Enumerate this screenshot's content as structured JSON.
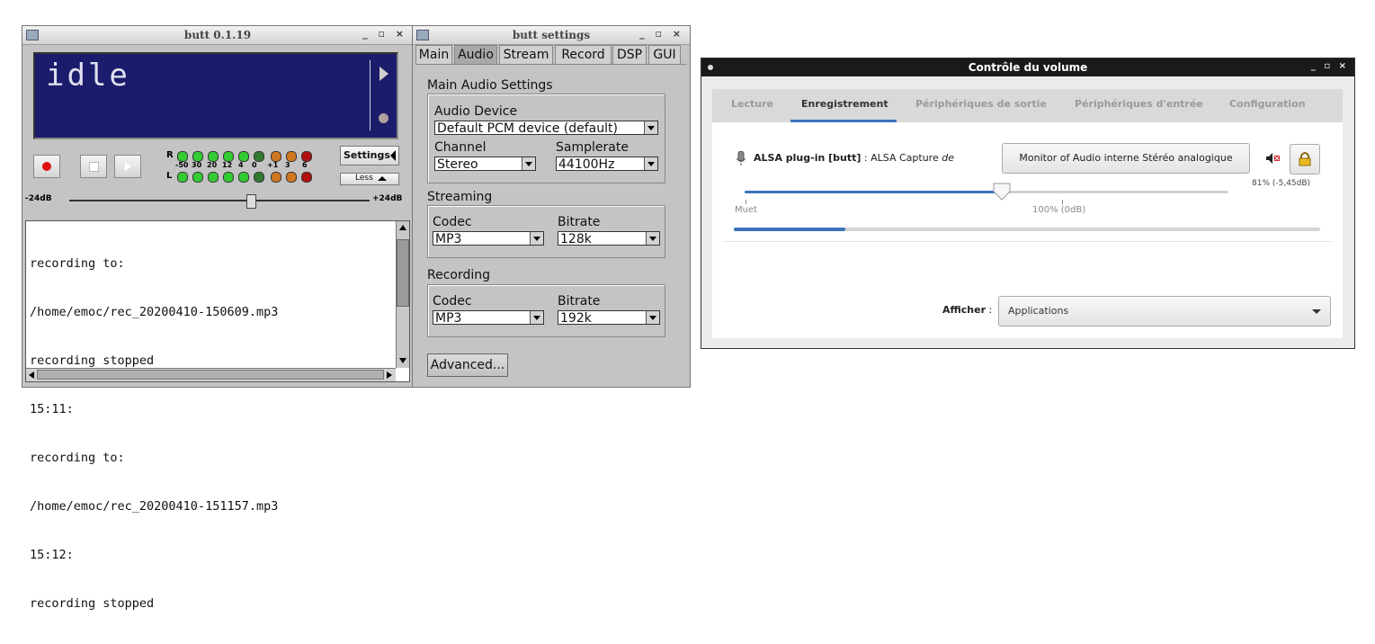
{
  "butt": {
    "title": "butt 0.1.19",
    "window_controls": "_ ▫ ×",
    "display_text": "idle",
    "vu": {
      "r_label": "R",
      "l_label": "L",
      "scale": [
        "-50",
        "30",
        "20",
        "12",
        "4",
        "0",
        "+1",
        "3",
        "6"
      ]
    },
    "settings_button": "Settings",
    "less_button": "Less",
    "gain_min": "-24dB",
    "gain_max": "+24dB",
    "log_lines": [
      "recording to:",
      "/home/emoc/rec_20200410-150609.mp3",
      "recording stopped",
      "15:11:",
      "recording to:",
      "/home/emoc/rec_20200410-151157.mp3",
      "15:12:",
      "recording stopped"
    ]
  },
  "settings": {
    "title": "butt settings",
    "window_controls": "_ ▫ ×",
    "tabs": [
      "Main",
      "Audio",
      "Stream",
      "Record",
      "DSP",
      "GUI"
    ],
    "active_tab": "Audio",
    "main_audio_heading": "Main Audio Settings",
    "audio_device_label": "Audio Device",
    "audio_device_value": "Default PCM device (default)",
    "channel_label": "Channel",
    "channel_value": "Stereo",
    "samplerate_label": "Samplerate",
    "samplerate_value": "44100Hz",
    "streaming_heading": "Streaming",
    "stream_codec_label": "Codec",
    "stream_codec_value": "MP3",
    "stream_bitrate_label": "Bitrate",
    "stream_bitrate_value": "128k",
    "recording_heading": "Recording",
    "rec_codec_label": "Codec",
    "rec_codec_value": "MP3",
    "rec_bitrate_label": "Bitrate",
    "rec_bitrate_value": "192k",
    "advanced_button": "Advanced..."
  },
  "volume": {
    "title": "Contrôle du volume",
    "window_controls": "_ ▫ ×",
    "tabs": [
      "Lecture",
      "Enregistrement",
      "Périphériques de sortie",
      "Périphériques d'entrée",
      "Configuration"
    ],
    "active_tab": "Enregistrement",
    "stream_name": "ALSA plug-in [butt]",
    "stream_sep": " : ",
    "stream_desc": "ALSA Capture",
    "stream_desc_em": "de",
    "source_button": "Monitor of Audio interne Stéréo analogique",
    "level_text": "81% (-5,45dB)",
    "mute_label": "Muet",
    "hundred_label": "100% (0dB)",
    "volume_fraction": 0.81,
    "peak_fraction": 0.19,
    "show_label": "Afficher",
    "show_colon": ":",
    "show_value": "Applications",
    "accent": "#3b73b9"
  }
}
